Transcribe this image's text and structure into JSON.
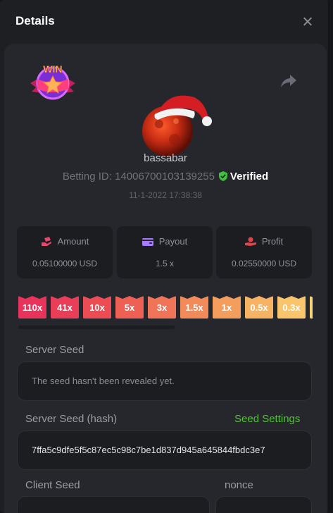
{
  "modal": {
    "title": "Details"
  },
  "player": {
    "username": "bassabar",
    "betting_id_label": "Betting ID:",
    "betting_id": "14006700103139255",
    "verified_label": "Verified",
    "datetime": "11-1-2022 17:38:38",
    "badge_text": "WIN"
  },
  "stats": [
    {
      "label": "Amount",
      "value": "0.05100000 USD",
      "icon": "money-hand-icon",
      "color": "#e8466a"
    },
    {
      "label": "Payout",
      "value": "1.5 x",
      "icon": "wallet-icon",
      "color": "#a67bff"
    },
    {
      "label": "Profit",
      "value": "0.02550000 USD",
      "icon": "coin-hand-icon",
      "color": "#e0434b"
    }
  ],
  "multipliers": [
    {
      "label": "110x",
      "color": "#e8335a"
    },
    {
      "label": "41x",
      "color": "#ea3d58"
    },
    {
      "label": "10x",
      "color": "#ec4d55"
    },
    {
      "label": "5x",
      "color": "#ee5f54"
    },
    {
      "label": "3x",
      "color": "#f07457"
    },
    {
      "label": "1.5x",
      "color": "#f28a5a"
    },
    {
      "label": "1x",
      "color": "#f49e5d"
    },
    {
      "label": "0.5x",
      "color": "#f6b364"
    },
    {
      "label": "0.3x",
      "color": "#f8c46c"
    },
    {
      "label": "",
      "color": "#f9d274"
    }
  ],
  "server_seed": {
    "label": "Server Seed",
    "value": "The seed hasn't been revealed yet."
  },
  "server_seed_hash": {
    "label": "Server Seed (hash)",
    "settings_link": "Seed Settings",
    "value": "7ffa5c9dfe5f5c87ec5c98c7be1d837d945a645844fbdc3e7"
  },
  "client_seed": {
    "label": "Client Seed"
  },
  "nonce": {
    "label": "nonce"
  }
}
